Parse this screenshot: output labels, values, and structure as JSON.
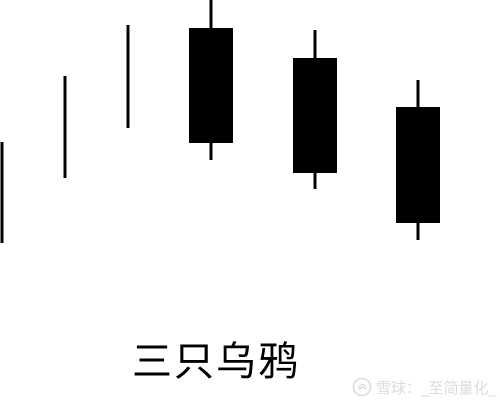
{
  "chart_data": {
    "type": "candlestick",
    "title": "三只乌鸦",
    "ylim": [
      0,
      405
    ],
    "axes_visible": false,
    "grid": false,
    "colors": {
      "candle": "#000000",
      "background": "#ffffff"
    },
    "candles": [
      {
        "name": "candle-1",
        "kind": "line",
        "low": 162,
        "high": 263
      },
      {
        "name": "candle-2",
        "kind": "line",
        "low": 227,
        "high": 329
      },
      {
        "name": "candle-3",
        "kind": "line",
        "low": 277,
        "high": 380
      },
      {
        "name": "candle-4",
        "kind": "bearish",
        "open": 377,
        "close": 262,
        "high": 405,
        "low": 245
      },
      {
        "name": "candle-5",
        "kind": "bearish",
        "open": 347,
        "close": 232,
        "high": 375,
        "low": 216
      },
      {
        "name": "candle-6",
        "kind": "bearish",
        "open": 298,
        "close": 182,
        "high": 325,
        "low": 165
      }
    ]
  },
  "watermark": {
    "text": "雪球：_至简量化_",
    "icon": "snowball-logo-icon",
    "color": "#bfbfbf"
  }
}
